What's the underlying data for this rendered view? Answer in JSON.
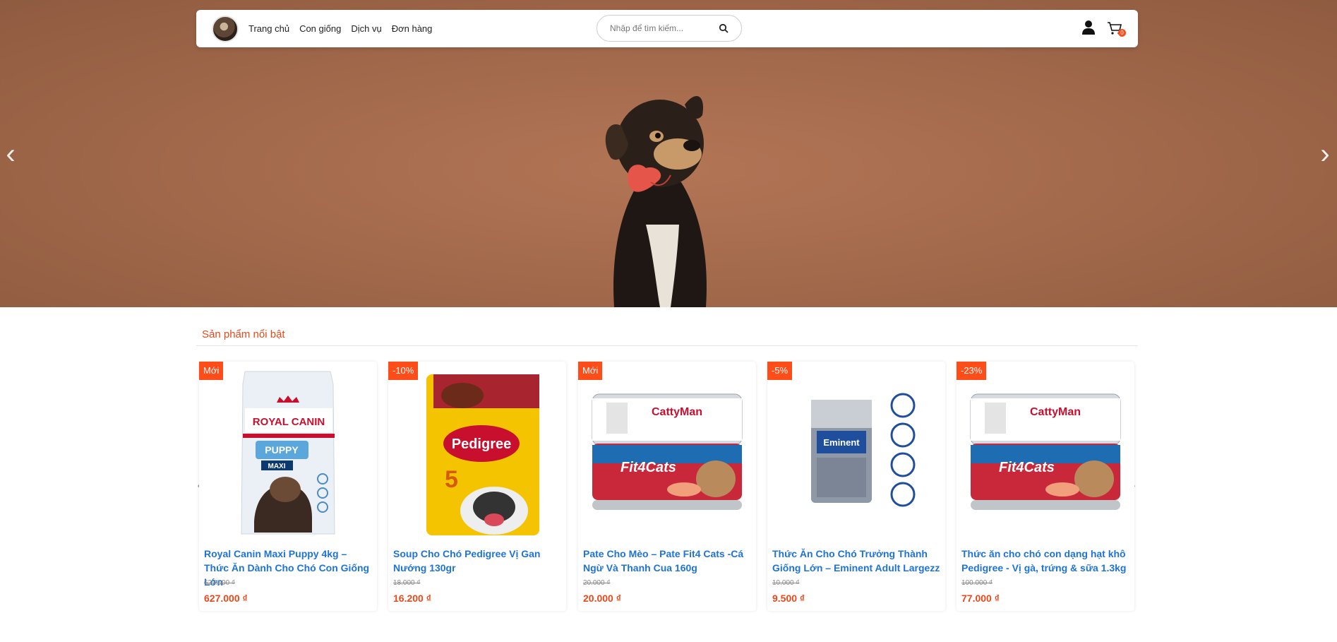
{
  "nav": {
    "links": [
      "Trang chủ",
      "Con giống",
      "Dịch vụ",
      "Đơn hàng"
    ],
    "search_placeholder": "Nhập để tìm kiếm...",
    "cart_count": "0"
  },
  "hero": {
    "prev": "‹",
    "next": "›"
  },
  "featured": {
    "title": "Sản phẩm nổi bật",
    "products": [
      {
        "badge": "Mới",
        "name": "Royal Canin Maxi Puppy 4kg – Thức Ăn Dành Cho Chó Con Giống Lớn",
        "old_price": "627.000 ₫",
        "price": "627.000 ₫"
      },
      {
        "badge": "-10%",
        "name": "Soup Cho Chó Pedigree Vị Gan Nướng 130gr",
        "old_price": "18.000 ₫",
        "price": "16.200 ₫"
      },
      {
        "badge": "Mới",
        "name": "Pate Cho Mèo – Pate Fit4 Cats -Cá Ngừ Và Thanh Cua 160g",
        "old_price": "20.000 ₫",
        "price": "20.000 ₫"
      },
      {
        "badge": "-5%",
        "name": "Thức Ăn Cho Chó Trưởng Thành Giống Lớn – Eminent Adult Largezz",
        "old_price": "10.000 ₫",
        "price": "9.500 ₫"
      },
      {
        "badge": "-23%",
        "name": "Thức ăn cho chó con dạng hạt khô Pedigree - Vị gà, trứng & sữa 1.3kg",
        "old_price": "100.000 ₫",
        "price": "77.000 ₫"
      }
    ],
    "package_text": {
      "royal": "ROYAL CANIN",
      "puppy": "PUPPY",
      "maxi": "MAXI",
      "pedigree": "Pedigree",
      "cattyman": "CattyMan",
      "fit4cats": "Fit4Cats",
      "eminent": "Eminent"
    }
  },
  "colors": {
    "accent": "#e8491b",
    "link": "#1e73d8",
    "badge": "#ff4d1a"
  },
  "icons": [
    "user-icon",
    "cart-icon",
    "search-icon",
    "chevron-left-icon",
    "chevron-right-icon"
  ]
}
